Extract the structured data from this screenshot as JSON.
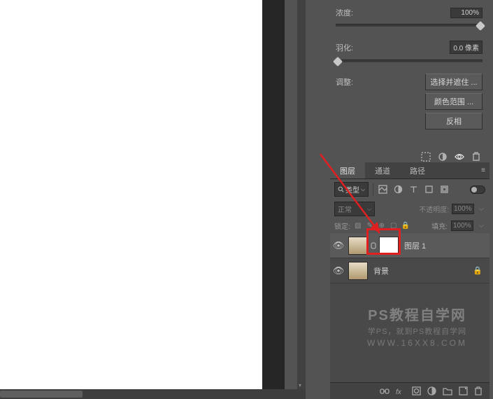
{
  "mask_panel": {
    "density_label": "浓度:",
    "density_value": "100%",
    "feather_label": "羽化:",
    "feather_value": "0.0 像素",
    "adjust_label": "调整:",
    "select_mask_btn": "选择并遮住 ...",
    "color_range_btn": "颜色范围 ...",
    "invert_btn": "反相"
  },
  "layers_panel": {
    "tabs": {
      "layers": "图层",
      "channels": "通道",
      "paths": "路径"
    },
    "type_filter": "类型",
    "blend_mode": "正常",
    "opacity_label": "不透明度:",
    "opacity_value": "100%",
    "lock_label": "锁定:",
    "fill_label": "填充:",
    "fill_value": "100%",
    "layers": [
      {
        "name": "图层 1",
        "has_mask": true,
        "selected": true,
        "locked": false
      },
      {
        "name": "背景",
        "has_mask": false,
        "selected": false,
        "locked": true
      }
    ]
  },
  "watermark": {
    "line1": "PS教程自学网",
    "line2": "学PS，就到PS教程自学网",
    "line3": "WWW.16XX8.COM"
  }
}
